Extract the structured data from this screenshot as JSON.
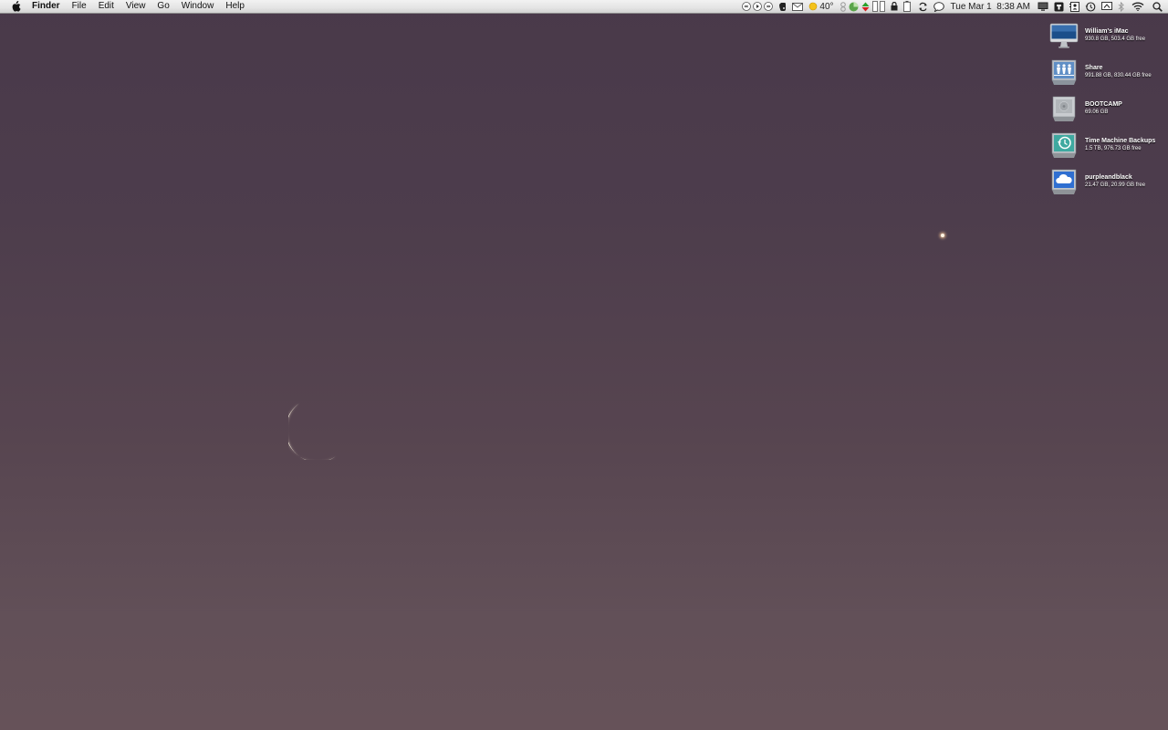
{
  "menubar": {
    "app_name": "Finder",
    "menus": [
      "File",
      "Edit",
      "View",
      "Go",
      "Window",
      "Help"
    ],
    "status": {
      "temperature": "40°",
      "clock": "Tue Mar 1  8:38 AM"
    }
  },
  "desktop_icons": [
    {
      "name": "William's iMac",
      "info": "930.8 GB, 503.4 GB free",
      "icon": "imac-icon"
    },
    {
      "name": "Share",
      "info": "991.88 GB, 830.44 GB free",
      "icon": "network-share-icon"
    },
    {
      "name": "BOOTCAMP",
      "info": "69.06 GB",
      "icon": "hard-drive-icon"
    },
    {
      "name": "Time Machine Backups",
      "info": "1.5 TB, 976.73 GB free",
      "icon": "time-machine-drive-icon"
    },
    {
      "name": "purpleandblack",
      "info": "21.47 GB, 20.99 GB free",
      "icon": "cloud-drive-icon"
    }
  ],
  "colors": {
    "wallpaper_top": "#49394a",
    "wallpaper_bottom": "#665259",
    "menubar": "#e4e4e4"
  }
}
